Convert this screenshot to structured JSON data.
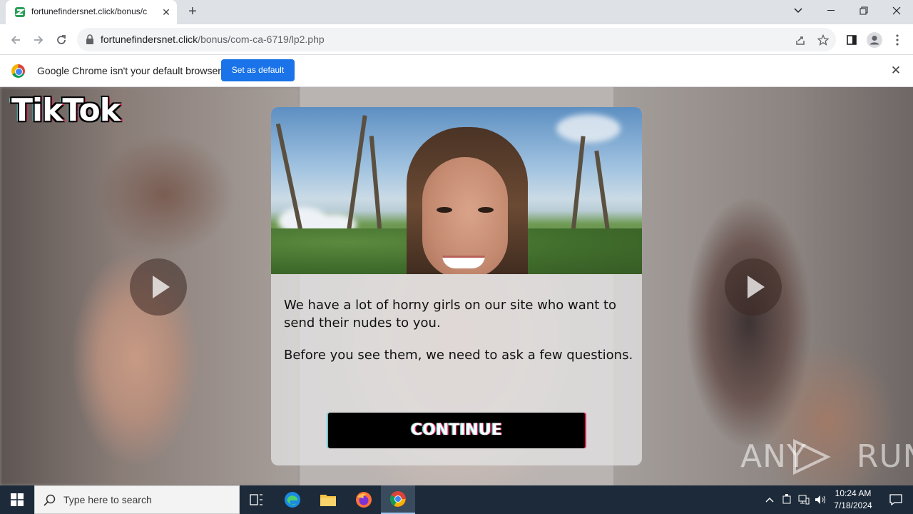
{
  "browser": {
    "tab_title": "fortunefindersnet.click/bonus/c",
    "new_tab_label": "+",
    "url_host": "fortunefindersnet.click",
    "url_path": "/bonus/com-ca-6719/lp2.php"
  },
  "infobar": {
    "message": "Google Chrome isn't your default browser",
    "button_label": "Set as default",
    "close_label": "✕"
  },
  "page": {
    "logo_text": "TikTok",
    "modal": {
      "paragraph1": "We have a lot of horny girls on our site who want to send their nudes to you.",
      "paragraph2": "Before you see them, we need to ask a few questions.",
      "continue_label": "CONTINUE"
    },
    "watermark_left": "ANY",
    "watermark_right": "RUN"
  },
  "taskbar": {
    "search_placeholder": "Type here to search",
    "time": "10:24 AM",
    "date": "7/18/2024"
  }
}
